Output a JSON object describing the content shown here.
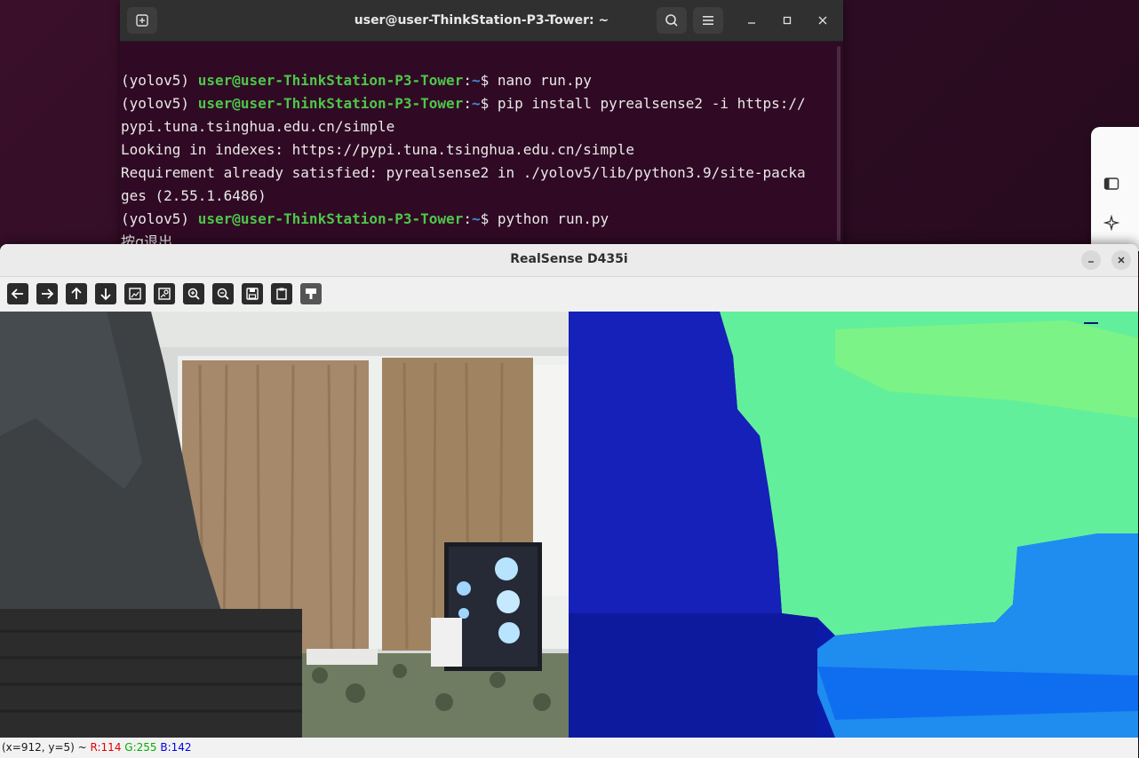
{
  "terminal": {
    "title": "user@user-ThinkStation-P3-Tower: ~",
    "lines": [
      {
        "env": "(yolov5) ",
        "user": "user@user-ThinkStation-P3-Tower",
        "sep": ":",
        "path": "~",
        "prompt": "$ ",
        "cmd": "nano run.py"
      },
      {
        "env": "(yolov5) ",
        "user": "user@user-ThinkStation-P3-Tower",
        "sep": ":",
        "path": "~",
        "prompt": "$ ",
        "cmd": "pip install pyrealsense2 -i https://"
      },
      {
        "text": "pypi.tuna.tsinghua.edu.cn/simple"
      },
      {
        "text": "Looking in indexes: https://pypi.tuna.tsinghua.edu.cn/simple"
      },
      {
        "text": "Requirement already satisfied: pyrealsense2 in ./yolov5/lib/python3.9/site-packa"
      },
      {
        "text": "ges (2.55.1.6486)"
      },
      {
        "env": "(yolov5) ",
        "user": "user@user-ThinkStation-P3-Tower",
        "sep": ":",
        "path": "~",
        "prompt": "$ ",
        "cmd": "python run.py"
      },
      {
        "text": "按q退出"
      }
    ]
  },
  "realsense": {
    "title": "RealSense D435i",
    "toolbar": [
      {
        "name": "pan-left-icon"
      },
      {
        "name": "pan-right-icon"
      },
      {
        "name": "pan-up-icon"
      },
      {
        "name": "pan-down-icon"
      },
      {
        "name": "zoom-fit-icon"
      },
      {
        "name": "zoom-original-icon"
      },
      {
        "name": "zoom-in-icon"
      },
      {
        "name": "zoom-out-icon"
      },
      {
        "name": "save-icon"
      },
      {
        "name": "properties-icon"
      },
      {
        "name": "copy-icon"
      }
    ],
    "status": {
      "coords": "(x=912, y=5) ~ ",
      "r": "R:114",
      "g": "G:255",
      "b": "B:142"
    }
  },
  "colors": {
    "terminal_bg": "#300a24",
    "prompt_user": "#4ec64a",
    "prompt_path": "#3f8fd6"
  }
}
